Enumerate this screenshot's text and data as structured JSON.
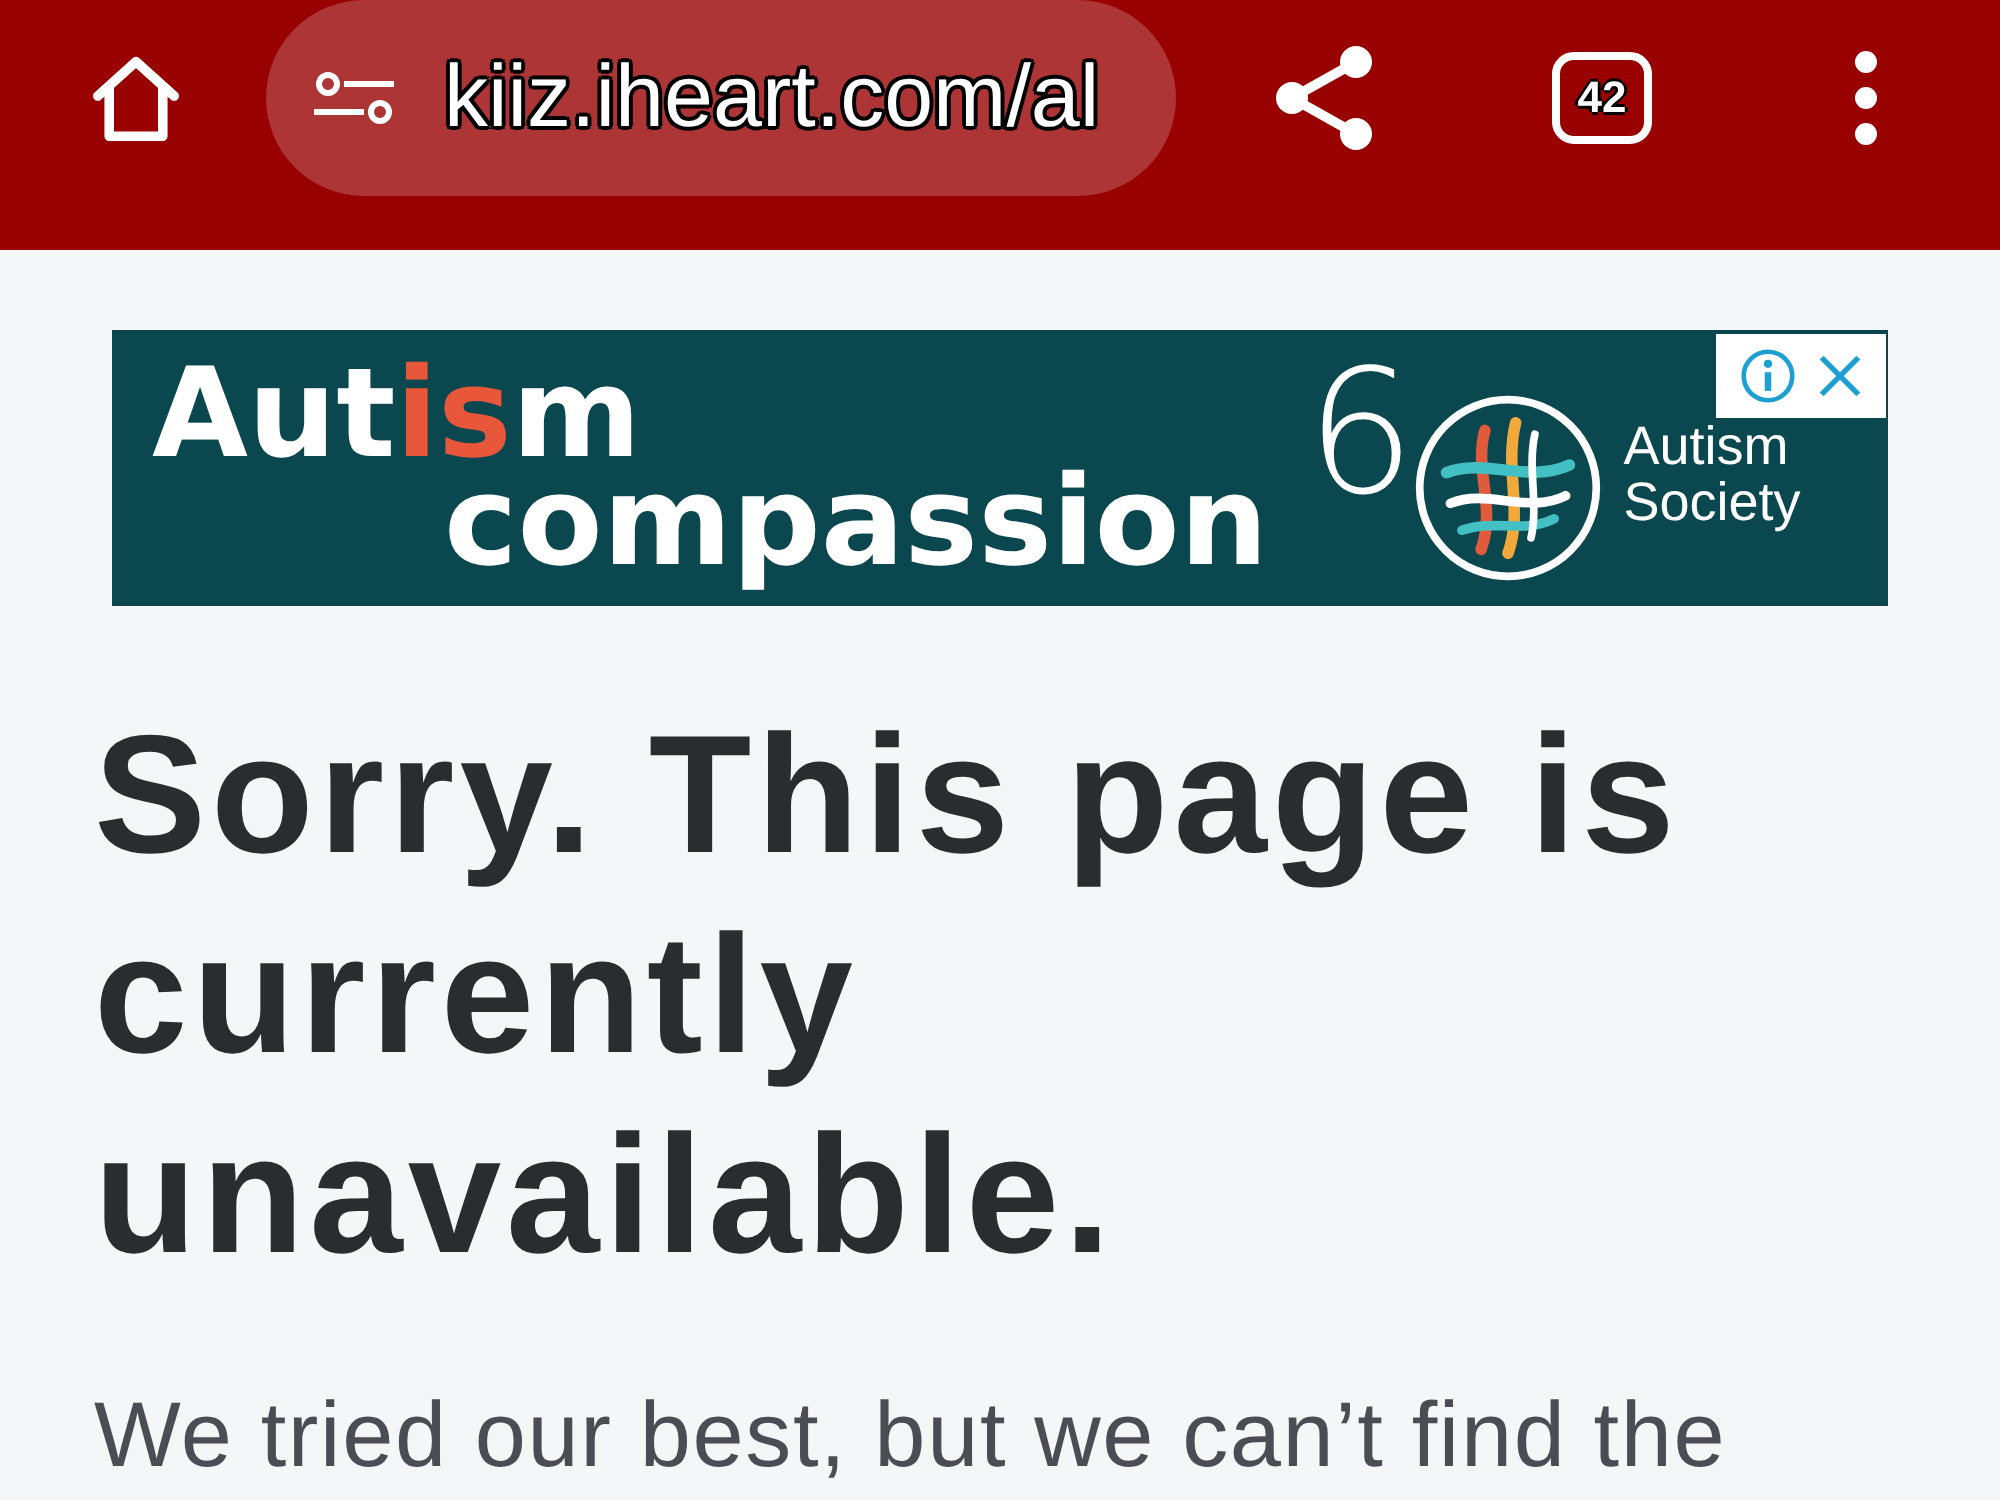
{
  "browser_bar": {
    "url": "kiiz.iheart.com/al",
    "tab_count": "42"
  },
  "ad_banner": {
    "headline": [
      {
        "text": "Aut",
        "accent": false
      },
      {
        "text": "is",
        "accent": true
      },
      {
        "text": "m",
        "accent": false
      }
    ],
    "subline": "compassion",
    "emblem_numeral": "6",
    "brand_name": "Autism Society"
  },
  "error_page": {
    "title": "Sorry. This page is currently unavailable.",
    "message": "We tried our best, but we can’t find the"
  }
}
